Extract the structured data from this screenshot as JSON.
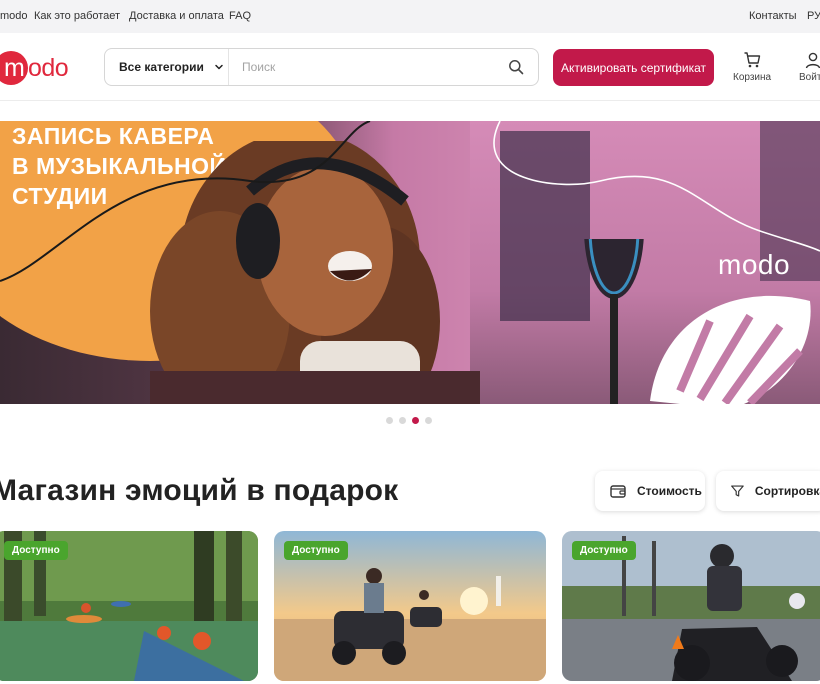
{
  "topbar": {
    "links": [
      "modo",
      "Как это работает",
      "Доставка и оплата",
      "FAQ"
    ],
    "right": [
      "Контакты",
      "РУ"
    ]
  },
  "header": {
    "logo_text": "modo",
    "category_button": "Все категории",
    "search_placeholder": "Поиск",
    "activate_button": "Активировать сертификат",
    "cart_label": "Корзина",
    "login_label": "Войти"
  },
  "banner": {
    "title_lines": [
      "ЗАПИСЬ КАВЕРА",
      "В МУЗЫКАЛЬНОЙ",
      "СТУДИИ"
    ],
    "brand": "modo",
    "slides_total": 4,
    "active_slide": 3
  },
  "section": {
    "title": "Магазин эмоций в подарок",
    "price_filter": "Стоимость",
    "sort_filter": "Сортировка"
  },
  "cards": [
    {
      "badge": "Доступно",
      "image": "kayaking-river-photo"
    },
    {
      "badge": "Доступно",
      "image": "quad-bike-beach-photo"
    },
    {
      "badge": "Доступно",
      "image": "motorcycle-training-photo"
    }
  ],
  "colors": {
    "brand_red": "#e0283d",
    "button_crimson": "#c2194a",
    "badge_green": "#4aa52d",
    "banner_orange": "#f2a247"
  }
}
